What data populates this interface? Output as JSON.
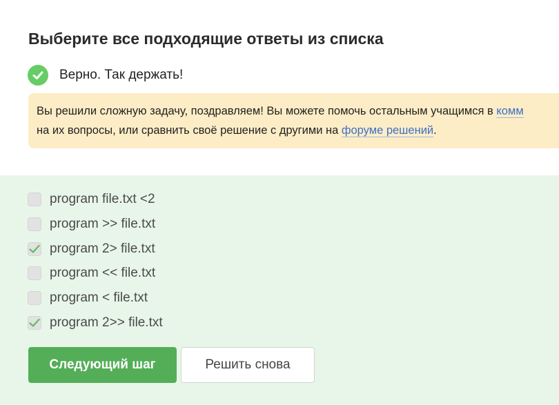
{
  "task": {
    "title": "Выберите все подходящие ответы из списка"
  },
  "verdict": {
    "icon": "check-circle-icon",
    "text": "Верно. Так держать!",
    "color": "#66cc66"
  },
  "notice": {
    "line1_text": "Вы решили сложную задачу, поздравляем! Вы можете помочь остальным учащимся в ",
    "line1_link": "комм",
    "line2_text": "на их вопросы, или сравнить своё решение с другими на ",
    "line2_link": "форуме решений",
    "line2_end": ".",
    "background": "#fdedc6",
    "link_color": "#3d6fc5"
  },
  "options": [
    {
      "label": "program file.txt <2",
      "checked": false
    },
    {
      "label": "program >> file.txt",
      "checked": false
    },
    {
      "label": "program 2> file.txt",
      "checked": true
    },
    {
      "label": "program << file.txt",
      "checked": false
    },
    {
      "label": "program < file.txt",
      "checked": false
    },
    {
      "label": "program 2>> file.txt",
      "checked": true
    }
  ],
  "answers_background": "#e8f6e9",
  "buttons": {
    "next_label": "Следующий шаг",
    "retry_label": "Решить снова",
    "next_color": "#54ae58"
  }
}
